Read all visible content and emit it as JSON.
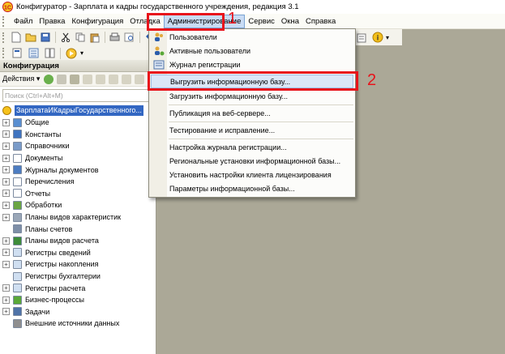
{
  "window": {
    "title": "Конфигуратор - Зарплата и кадры государственного учреждения, редакция 3.1"
  },
  "menubar": {
    "items": [
      "Файл",
      "Правка",
      "Конфигурация",
      "Отладка",
      "Администрирование",
      "Сервис",
      "Окна",
      "Справка"
    ]
  },
  "panel": {
    "title": "Конфигурация",
    "actions_label": "Действия ▾",
    "search_placeholder": "Поиск (Ctrl+Alt+M)",
    "root": "ЗарплатаИКадрыГосударственного...",
    "items": [
      {
        "label": "Общие",
        "expandable": true,
        "icon": "common-icon"
      },
      {
        "label": "Константы",
        "expandable": true,
        "icon": "constants-icon"
      },
      {
        "label": "Справочники",
        "expandable": true,
        "icon": "catalogs-icon"
      },
      {
        "label": "Документы",
        "expandable": true,
        "icon": "documents-icon"
      },
      {
        "label": "Журналы документов",
        "expandable": true,
        "icon": "document-journals-icon"
      },
      {
        "label": "Перечисления",
        "expandable": true,
        "icon": "enumerations-icon"
      },
      {
        "label": "Отчеты",
        "expandable": true,
        "icon": "reports-icon"
      },
      {
        "label": "Обработки",
        "expandable": true,
        "icon": "data-processors-icon"
      },
      {
        "label": "Планы видов характеристик",
        "expandable": true,
        "icon": "characteristic-types-icon"
      },
      {
        "label": "Планы счетов",
        "expandable": false,
        "icon": "charts-of-accounts-icon"
      },
      {
        "label": "Планы видов расчета",
        "expandable": true,
        "icon": "calculation-types-icon"
      },
      {
        "label": "Регистры сведений",
        "expandable": true,
        "icon": "information-registers-icon"
      },
      {
        "label": "Регистры накопления",
        "expandable": true,
        "icon": "accumulation-registers-icon"
      },
      {
        "label": "Регистры бухгалтерии",
        "expandable": false,
        "icon": "accounting-registers-icon"
      },
      {
        "label": "Регистры расчета",
        "expandable": true,
        "icon": "calculation-registers-icon"
      },
      {
        "label": "Бизнес-процессы",
        "expandable": true,
        "icon": "business-processes-icon"
      },
      {
        "label": "Задачи",
        "expandable": true,
        "icon": "tasks-icon"
      },
      {
        "label": "Внешние источники данных",
        "expandable": false,
        "icon": "external-data-sources-icon"
      }
    ]
  },
  "dropdown": {
    "items": [
      {
        "label": "Пользователи",
        "icon": "users-icon"
      },
      {
        "label": "Активные пользователи",
        "icon": "active-users-icon"
      },
      {
        "label": "Журнал регистрации",
        "icon": "event-log-icon"
      },
      {
        "label": "Выгрузить информационную базу...",
        "icon": ""
      },
      {
        "label": "Загрузить информационную базу...",
        "icon": ""
      },
      {
        "label": "Публикация на веб-сервере...",
        "icon": ""
      },
      {
        "label": "Тестирование и исправление...",
        "icon": ""
      },
      {
        "label": "Настройка журнала регистрации...",
        "icon": ""
      },
      {
        "label": "Региональные установки информационной базы...",
        "icon": ""
      },
      {
        "label": "Установить настройки клиента лицензирования",
        "icon": ""
      },
      {
        "label": "Параметры информационной базы...",
        "icon": ""
      }
    ]
  },
  "annotations": {
    "step1": "1",
    "step2": "2",
    "color": "#e8131b"
  },
  "colors": {
    "selection": "#3367c2",
    "menu_highlight": "#dbe7f7",
    "workspace": "#aba897"
  }
}
